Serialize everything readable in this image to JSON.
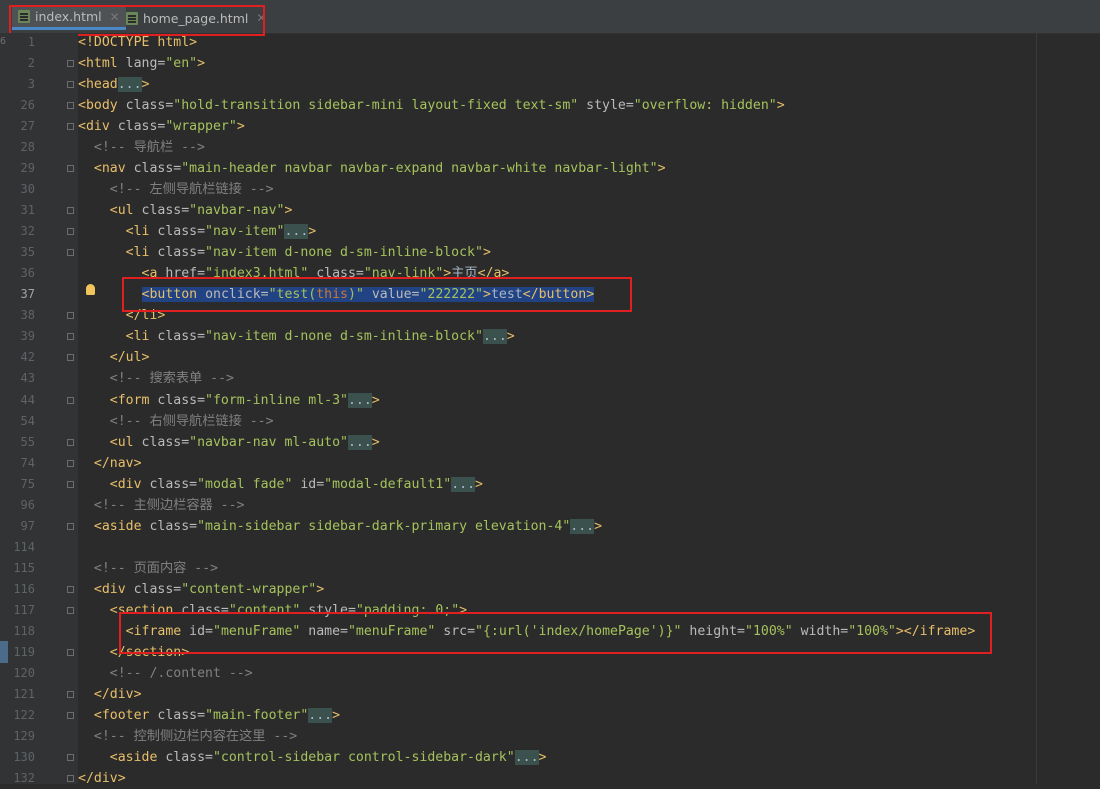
{
  "tabs": [
    {
      "label": "index.html",
      "active": true
    },
    {
      "label": "home_page.html",
      "active": false
    }
  ],
  "gutter_marker": "6",
  "current_line": "37",
  "lines": [
    {
      "num": "1",
      "segs": [
        [
          "tag",
          "<!DOCTYPE html>"
        ]
      ]
    },
    {
      "num": "2",
      "segs": [
        [
          "tag",
          "<html "
        ],
        [
          "attr",
          "lang="
        ],
        [
          "str",
          "\"en\""
        ],
        [
          "tag",
          ">"
        ]
      ]
    },
    {
      "num": "3",
      "segs": [
        [
          "tag",
          "<head"
        ],
        [
          "fold-box",
          "..."
        ],
        [
          "tag",
          ">"
        ]
      ]
    },
    {
      "num": "26",
      "segs": [
        [
          "tag",
          "<body "
        ],
        [
          "attr",
          "class="
        ],
        [
          "str",
          "\"hold-transition sidebar-mini layout-fixed text-sm\""
        ],
        [
          "attr",
          " style="
        ],
        [
          "str",
          "\"overflow: hidden\""
        ],
        [
          "tag",
          ">"
        ]
      ]
    },
    {
      "num": "27",
      "segs": [
        [
          "tag",
          "<div "
        ],
        [
          "attr",
          "class="
        ],
        [
          "str",
          "\"wrapper\""
        ],
        [
          "tag",
          ">"
        ]
      ]
    },
    {
      "num": "28",
      "segs": [
        [
          "txt",
          "  "
        ],
        [
          "cmt",
          "<!-- 导航栏 -->"
        ]
      ]
    },
    {
      "num": "29",
      "segs": [
        [
          "txt",
          "  "
        ],
        [
          "tag",
          "<nav "
        ],
        [
          "attr",
          "class="
        ],
        [
          "str",
          "\"main-header navbar navbar-expand navbar-white navbar-light\""
        ],
        [
          "tag",
          ">"
        ]
      ]
    },
    {
      "num": "30",
      "segs": [
        [
          "txt",
          "    "
        ],
        [
          "cmt",
          "<!-- 左侧导航栏链接 -->"
        ]
      ]
    },
    {
      "num": "31",
      "segs": [
        [
          "txt",
          "    "
        ],
        [
          "tag",
          "<ul "
        ],
        [
          "attr",
          "class="
        ],
        [
          "str",
          "\"navbar-nav\""
        ],
        [
          "tag",
          ">"
        ]
      ]
    },
    {
      "num": "32",
      "segs": [
        [
          "txt",
          "      "
        ],
        [
          "tag",
          "<li "
        ],
        [
          "attr",
          "class="
        ],
        [
          "str",
          "\"nav-item\""
        ],
        [
          "fold-box",
          "..."
        ],
        [
          "tag",
          ">"
        ]
      ]
    },
    {
      "num": "35",
      "segs": [
        [
          "txt",
          "      "
        ],
        [
          "tag",
          "<li "
        ],
        [
          "attr",
          "class="
        ],
        [
          "str",
          "\"nav-item d-none d-sm-inline-block\""
        ],
        [
          "tag",
          ">"
        ]
      ]
    },
    {
      "num": "36",
      "segs": [
        [
          "txt",
          "        "
        ],
        [
          "tag",
          "<a "
        ],
        [
          "attr",
          "href="
        ],
        [
          "str",
          "\"index3.html\""
        ],
        [
          "attr",
          " class="
        ],
        [
          "str",
          "\"nav-link\""
        ],
        [
          "tag",
          ">"
        ],
        [
          "txt",
          "主页"
        ],
        [
          "tag",
          "</a>"
        ]
      ]
    },
    {
      "num": "37",
      "segs": [
        [
          "txt",
          "        "
        ],
        [
          "tag sel",
          "<button "
        ],
        [
          "attr sel",
          "onclick="
        ],
        [
          "str sel",
          "\"test("
        ],
        [
          "kw sel",
          "this"
        ],
        [
          "str sel",
          ")\""
        ],
        [
          "attr sel",
          " value="
        ],
        [
          "str sel",
          "\"222222\""
        ],
        [
          "tag sel",
          ">"
        ],
        [
          "txt sel",
          "test"
        ],
        [
          "tag sel",
          "</button>"
        ]
      ]
    },
    {
      "num": "38",
      "segs": [
        [
          "txt",
          "      "
        ],
        [
          "tag",
          "</li>"
        ]
      ]
    },
    {
      "num": "39",
      "segs": [
        [
          "txt",
          "      "
        ],
        [
          "tag",
          "<li "
        ],
        [
          "attr",
          "class="
        ],
        [
          "str",
          "\"nav-item d-none d-sm-inline-block\""
        ],
        [
          "fold-box",
          "..."
        ],
        [
          "tag",
          ">"
        ]
      ]
    },
    {
      "num": "42",
      "segs": [
        [
          "txt",
          "    "
        ],
        [
          "tag",
          "</ul>"
        ]
      ]
    },
    {
      "num": "43",
      "segs": [
        [
          "txt",
          "    "
        ],
        [
          "cmt",
          "<!-- 搜索表单 -->"
        ]
      ]
    },
    {
      "num": "44",
      "segs": [
        [
          "txt",
          "    "
        ],
        [
          "tag",
          "<form "
        ],
        [
          "attr",
          "class="
        ],
        [
          "str",
          "\"form-inline ml-3\""
        ],
        [
          "fold-box",
          "..."
        ],
        [
          "tag",
          ">"
        ]
      ]
    },
    {
      "num": "54",
      "segs": [
        [
          "txt",
          "    "
        ],
        [
          "cmt",
          "<!-- 右侧导航栏链接 -->"
        ]
      ]
    },
    {
      "num": "55",
      "segs": [
        [
          "txt",
          "    "
        ],
        [
          "tag",
          "<ul "
        ],
        [
          "attr",
          "class="
        ],
        [
          "str",
          "\"navbar-nav ml-auto\""
        ],
        [
          "fold-box",
          "..."
        ],
        [
          "tag",
          ">"
        ]
      ]
    },
    {
      "num": "74",
      "segs": [
        [
          "txt",
          "  "
        ],
        [
          "tag",
          "</nav>"
        ]
      ]
    },
    {
      "num": "75",
      "segs": [
        [
          "txt",
          "    "
        ],
        [
          "tag",
          "<div "
        ],
        [
          "attr",
          "class="
        ],
        [
          "str",
          "\"modal fade\""
        ],
        [
          "attr",
          " id="
        ],
        [
          "str",
          "\"modal-default1\""
        ],
        [
          "fold-box",
          "..."
        ],
        [
          "tag",
          ">"
        ]
      ]
    },
    {
      "num": "96",
      "segs": [
        [
          "txt",
          "  "
        ],
        [
          "cmt",
          "<!-- 主侧边栏容器 -->"
        ]
      ]
    },
    {
      "num": "97",
      "segs": [
        [
          "txt",
          "  "
        ],
        [
          "tag",
          "<aside "
        ],
        [
          "attr",
          "class="
        ],
        [
          "str",
          "\"main-sidebar sidebar-dark-primary elevation-4\""
        ],
        [
          "fold-box",
          "..."
        ],
        [
          "tag",
          ">"
        ]
      ]
    },
    {
      "num": "114",
      "segs": []
    },
    {
      "num": "115",
      "segs": [
        [
          "txt",
          "  "
        ],
        [
          "cmt",
          "<!-- 页面内容 -->"
        ]
      ]
    },
    {
      "num": "116",
      "segs": [
        [
          "txt",
          "  "
        ],
        [
          "tag",
          "<div "
        ],
        [
          "attr",
          "class="
        ],
        [
          "str",
          "\"content-wrapper\""
        ],
        [
          "tag",
          ">"
        ]
      ]
    },
    {
      "num": "117",
      "segs": [
        [
          "txt",
          "    "
        ],
        [
          "tag",
          "<section "
        ],
        [
          "attr",
          "class="
        ],
        [
          "str",
          "\"content\""
        ],
        [
          "attr",
          " style="
        ],
        [
          "str",
          "\"padding: 0;\""
        ],
        [
          "tag",
          ">"
        ]
      ]
    },
    {
      "num": "118",
      "segs": [
        [
          "txt",
          "      "
        ],
        [
          "tag",
          "<iframe "
        ],
        [
          "attr",
          "id="
        ],
        [
          "str",
          "\"menuFrame\""
        ],
        [
          "attr",
          " name="
        ],
        [
          "str",
          "\"menuFrame\""
        ],
        [
          "attr",
          " src="
        ],
        [
          "str",
          "\"{:url('index/homePage')}\""
        ],
        [
          "attr",
          " height="
        ],
        [
          "str",
          "\"100%\""
        ],
        [
          "attr",
          " width="
        ],
        [
          "str",
          "\"100%\""
        ],
        [
          "tag",
          "></iframe>"
        ]
      ]
    },
    {
      "num": "119",
      "segs": [
        [
          "txt",
          "    "
        ],
        [
          "tag",
          "</section>"
        ]
      ]
    },
    {
      "num": "120",
      "segs": [
        [
          "txt",
          "    "
        ],
        [
          "cmt",
          "<!-- /.content -->"
        ]
      ]
    },
    {
      "num": "121",
      "segs": [
        [
          "txt",
          "  "
        ],
        [
          "tag",
          "</div>"
        ]
      ]
    },
    {
      "num": "122",
      "segs": [
        [
          "txt",
          "  "
        ],
        [
          "tag",
          "<footer "
        ],
        [
          "attr",
          "class="
        ],
        [
          "str",
          "\"main-footer\""
        ],
        [
          "fold-box",
          "..."
        ],
        [
          "tag",
          ">"
        ]
      ]
    },
    {
      "num": "129",
      "segs": [
        [
          "txt",
          "  "
        ],
        [
          "cmt",
          "<!-- 控制侧边栏内容在这里 -->"
        ]
      ]
    },
    {
      "num": "130",
      "segs": [
        [
          "txt",
          "    "
        ],
        [
          "tag",
          "<aside "
        ],
        [
          "attr",
          "class="
        ],
        [
          "str",
          "\"control-sidebar control-sidebar-dark\""
        ],
        [
          "fold-box",
          "..."
        ],
        [
          "tag",
          ">"
        ]
      ]
    },
    {
      "num": "132",
      "segs": [
        [
          "tag",
          "</div>"
        ]
      ]
    }
  ]
}
